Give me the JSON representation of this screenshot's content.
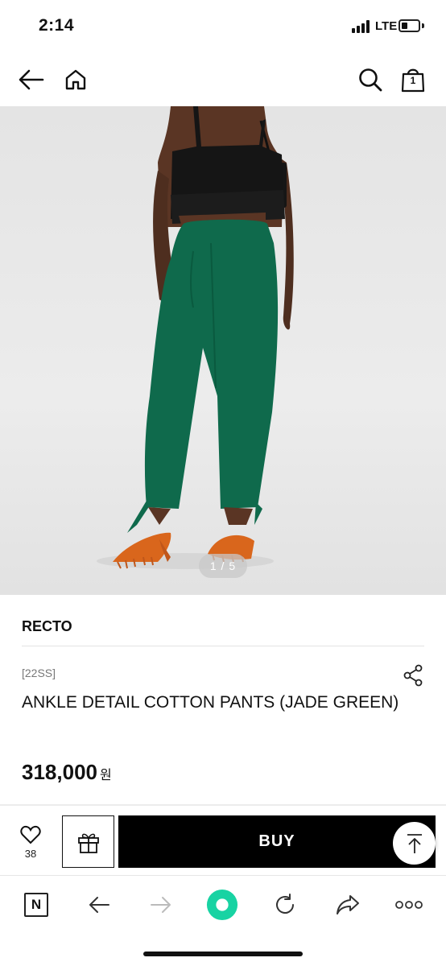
{
  "status_bar": {
    "time": "2:14",
    "network": "LTE"
  },
  "header": {
    "cart_count": "1"
  },
  "gallery": {
    "counter": "1 / 5"
  },
  "product": {
    "brand": "RECTO",
    "season": "[22SS]",
    "name": "ANKLE DETAIL COTTON PANTS (JADE GREEN)",
    "price": "318,000",
    "currency": "원"
  },
  "actions": {
    "like_count": "38",
    "buy_label": "BUY"
  },
  "browser": {
    "logo_letter": "N",
    "accent_color": "#18d3a3"
  },
  "colors": {
    "pants": "#0f6a4c",
    "top": "#151515",
    "shoes": "#d9661c"
  }
}
